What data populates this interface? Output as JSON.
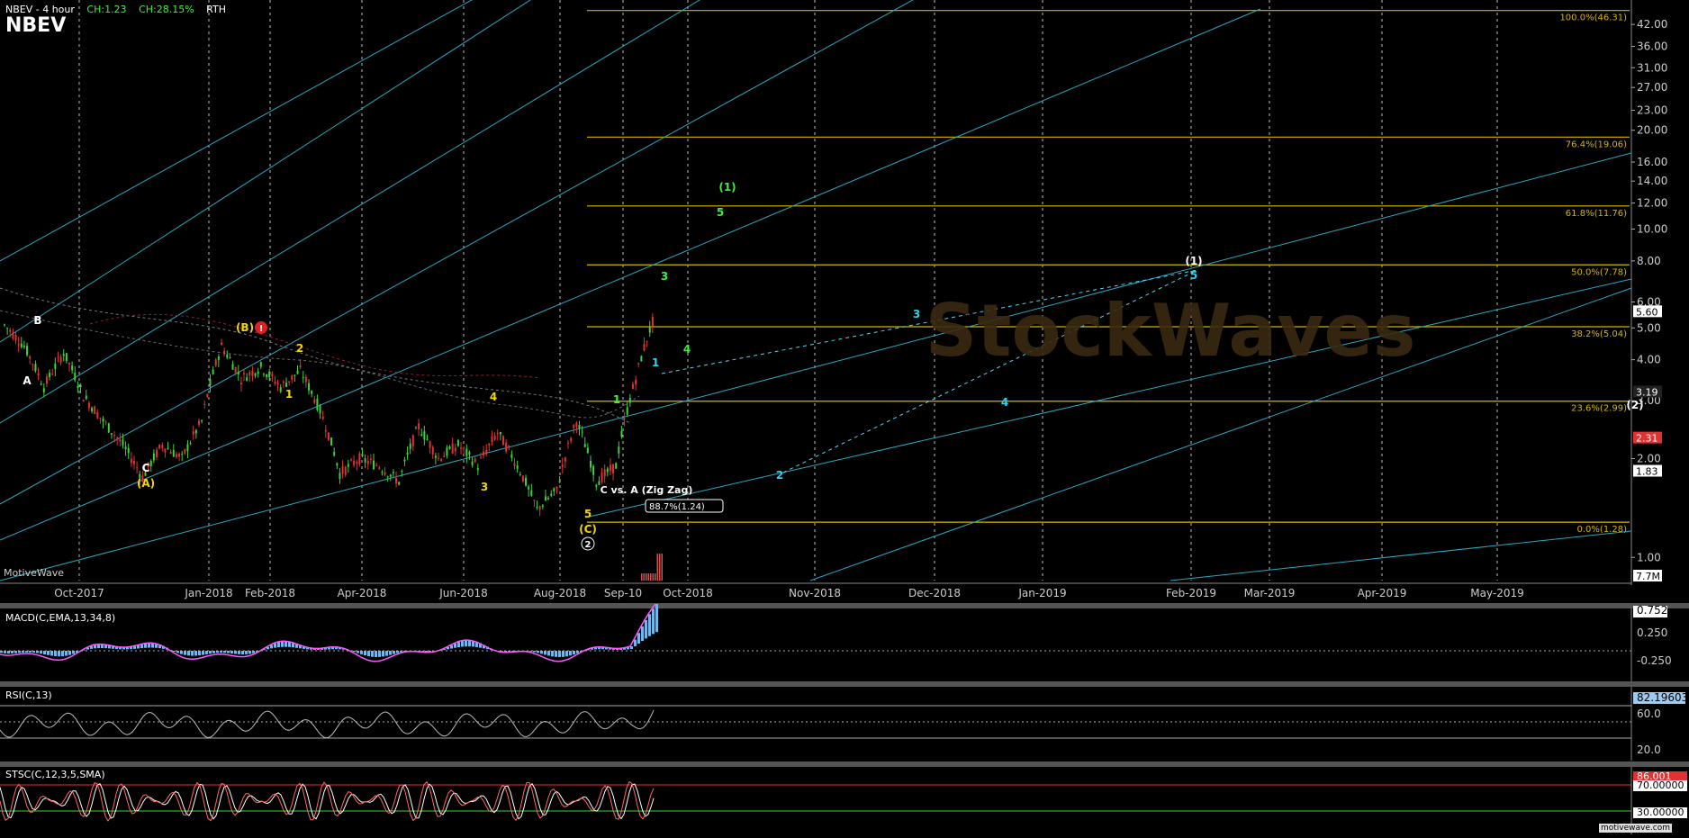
{
  "header": {
    "title": "NBEV - 4 hour",
    "symbol": "NBEV",
    "change1": "CH:1.23",
    "change2": "CH:28.15%",
    "session": "RTH"
  },
  "watermark": "MotiveWave",
  "site": "motivewave.com",
  "logo_text": "StockWaves",
  "colors": {
    "background": "#000000",
    "grid": "#2a2a2a",
    "fib": "#d4b400",
    "trendline": "#2aa7c0",
    "candle_up": "#3cd23c",
    "candle_down": "#e03232",
    "macd": "#ff55ff",
    "macd_hist": "#6fb8e8",
    "rsi": "#bbbbbb",
    "stsc_k": "#ff6666",
    "stsc_d": "#ffffff",
    "level_red": "#e03232",
    "level_green": "#3cd23c"
  },
  "chart_data": {
    "type": "line",
    "title": "NBEV - 4 hour",
    "x_axis_labels": [
      "Oct-2017",
      "Jan-2018",
      "Feb-2018",
      "Apr-2018",
      "Jun-2018",
      "Aug-2018",
      "Sep-10",
      "Oct-2018",
      "Nov-2018",
      "Dec-2018",
      "Jan-2019",
      "Feb-2019",
      "Mar-2019",
      "Apr-2019",
      "May-2019"
    ],
    "y_axis_labels": [
      "42.00",
      "36.00",
      "31.00",
      "27.00",
      "23.00",
      "20.00",
      "16.00",
      "14.00",
      "12.00",
      "10.00",
      "8.00",
      "6.00",
      "5.00",
      "4.00",
      "3.00",
      "2.00",
      "1.00"
    ],
    "y_scale": "log",
    "ylim": [
      0.85,
      48
    ],
    "price": [
      [
        "Sep-2017",
        5.1
      ],
      [
        "Sep-2017",
        4.4
      ],
      [
        "Oct-2017",
        3.3
      ],
      [
        "Oct-2017",
        4.2
      ],
      [
        "Nov-2017",
        3.1
      ],
      [
        "Nov-2017",
        2.6
      ],
      [
        "Dec-2017",
        2.2
      ],
      [
        "Dec-2017",
        1.75
      ],
      [
        "Dec-2017",
        2.2
      ],
      [
        "Jan-2018",
        2.0
      ],
      [
        "Jan-2018",
        2.6
      ],
      [
        "Jan-2018",
        4.4
      ],
      [
        "Feb-2018",
        3.5
      ],
      [
        "Feb-2018",
        3.8
      ],
      [
        "Mar-2018",
        3.3
      ],
      [
        "Mar-2018",
        3.7
      ],
      [
        "Apr-2018",
        2.8
      ],
      [
        "Apr-2018",
        1.8
      ],
      [
        "May-2018",
        2.0
      ],
      [
        "May-2018",
        1.9
      ],
      [
        "Jun-2018",
        1.7
      ],
      [
        "Jun-2018",
        2.5
      ],
      [
        "Jun-2018",
        2.0
      ],
      [
        "Jul-2018",
        2.2
      ],
      [
        "Jul-2018",
        1.9
      ],
      [
        "Jul-2018",
        2.4
      ],
      [
        "Aug-2018",
        1.9
      ],
      [
        "Aug-2018",
        1.4
      ],
      [
        "Aug-2018",
        1.6
      ],
      [
        "Sep-2018",
        2.6
      ],
      [
        "Sep-2018",
        1.7
      ],
      [
        "Sep-2018",
        1.9
      ],
      [
        "Sep-2018",
        3.5
      ],
      [
        "Sep-2018",
        5.5
      ]
    ],
    "fib_levels": [
      {
        "label": "100.0%(46.31)",
        "value": 46.31
      },
      {
        "label": "76.4%(19.06)",
        "value": 19.06
      },
      {
        "label": "61.8%(11.76)",
        "value": 11.76
      },
      {
        "label": "50.0%(7.78)",
        "value": 7.78
      },
      {
        "label": "38.2%(5.04)",
        "value": 5.04
      },
      {
        "label": "23.6%(2.99)",
        "value": 2.99
      },
      {
        "label": "0.0%(1.28)",
        "value": 1.28
      }
    ],
    "price_tags": [
      {
        "label": "5.60",
        "value": 5.6,
        "bg": "#ffffff",
        "fg": "#000000"
      },
      {
        "label": "3.19",
        "value": 3.19,
        "bg": "#222222",
        "fg": "#ffffff"
      },
      {
        "label": "2.31",
        "value": 2.31,
        "bg": "#e03232",
        "fg": "#ffffff"
      },
      {
        "label": "1.83",
        "value": 1.83,
        "bg": "#ffffff",
        "fg": "#000000"
      },
      {
        "label": "7.7M",
        "value": 0.86,
        "bg": "#ffffff",
        "fg": "#000000"
      }
    ],
    "wave_labels": [
      {
        "text": "B",
        "color": "#ffffff"
      },
      {
        "text": "A",
        "color": "#ffffff"
      },
      {
        "text": "C",
        "color": "#ffffff"
      },
      {
        "text": "(A)",
        "color": "#f2d600"
      },
      {
        "text": "(B)",
        "color": "#f2d600"
      },
      {
        "text": "!",
        "color": "#ffffff"
      },
      {
        "text": "2",
        "color": "#f2d600"
      },
      {
        "text": "1",
        "color": "#f2d600"
      },
      {
        "text": "4",
        "color": "#f2d600"
      },
      {
        "text": "3",
        "color": "#f2d600"
      },
      {
        "text": "5",
        "color": "#f2d600"
      },
      {
        "text": "(C)",
        "color": "#f2d600"
      },
      {
        "text": "2",
        "color": "#ffffff"
      },
      {
        "text": "1",
        "color": "#3cf03c"
      },
      {
        "text": "3",
        "color": "#3cf03c"
      },
      {
        "text": "4",
        "color": "#3cf03c"
      },
      {
        "text": "5",
        "color": "#3cf03c"
      },
      {
        "text": "(1)",
        "color": "#3cf03c"
      },
      {
        "text": "1",
        "color": "#2fd0f0"
      },
      {
        "text": "2",
        "color": "#2fd0f0"
      },
      {
        "text": "3",
        "color": "#2fd0f0"
      },
      {
        "text": "4",
        "color": "#2fd0f0"
      },
      {
        "text": "5",
        "color": "#2fd0f0"
      },
      {
        "text": "(1)",
        "color": "#ffffff"
      },
      {
        "text": "(2)",
        "color": "#ffffff"
      },
      {
        "text": "C vs. A (Zig Zag)",
        "color": "#ffffff"
      },
      {
        "text": "88.7%(1.24)",
        "color": "#ffffff"
      }
    ],
    "macd": {
      "label": "MACD(C,EMA,13,34,8)",
      "y_axis_labels": [
        "0.752",
        "0.250",
        "-0.250"
      ],
      "last": 0.752
    },
    "rsi": {
      "label": "RSI(C,13)",
      "y_axis_labels": [
        "82.19603",
        "60.0",
        "20.0"
      ],
      "last": 82.19603
    },
    "stsc": {
      "label": "STSC(C,12,3,5,SMA)",
      "y_axis_labels": [
        "86.001",
        "70.00000",
        "30.00000"
      ],
      "last": 86.001
    }
  }
}
